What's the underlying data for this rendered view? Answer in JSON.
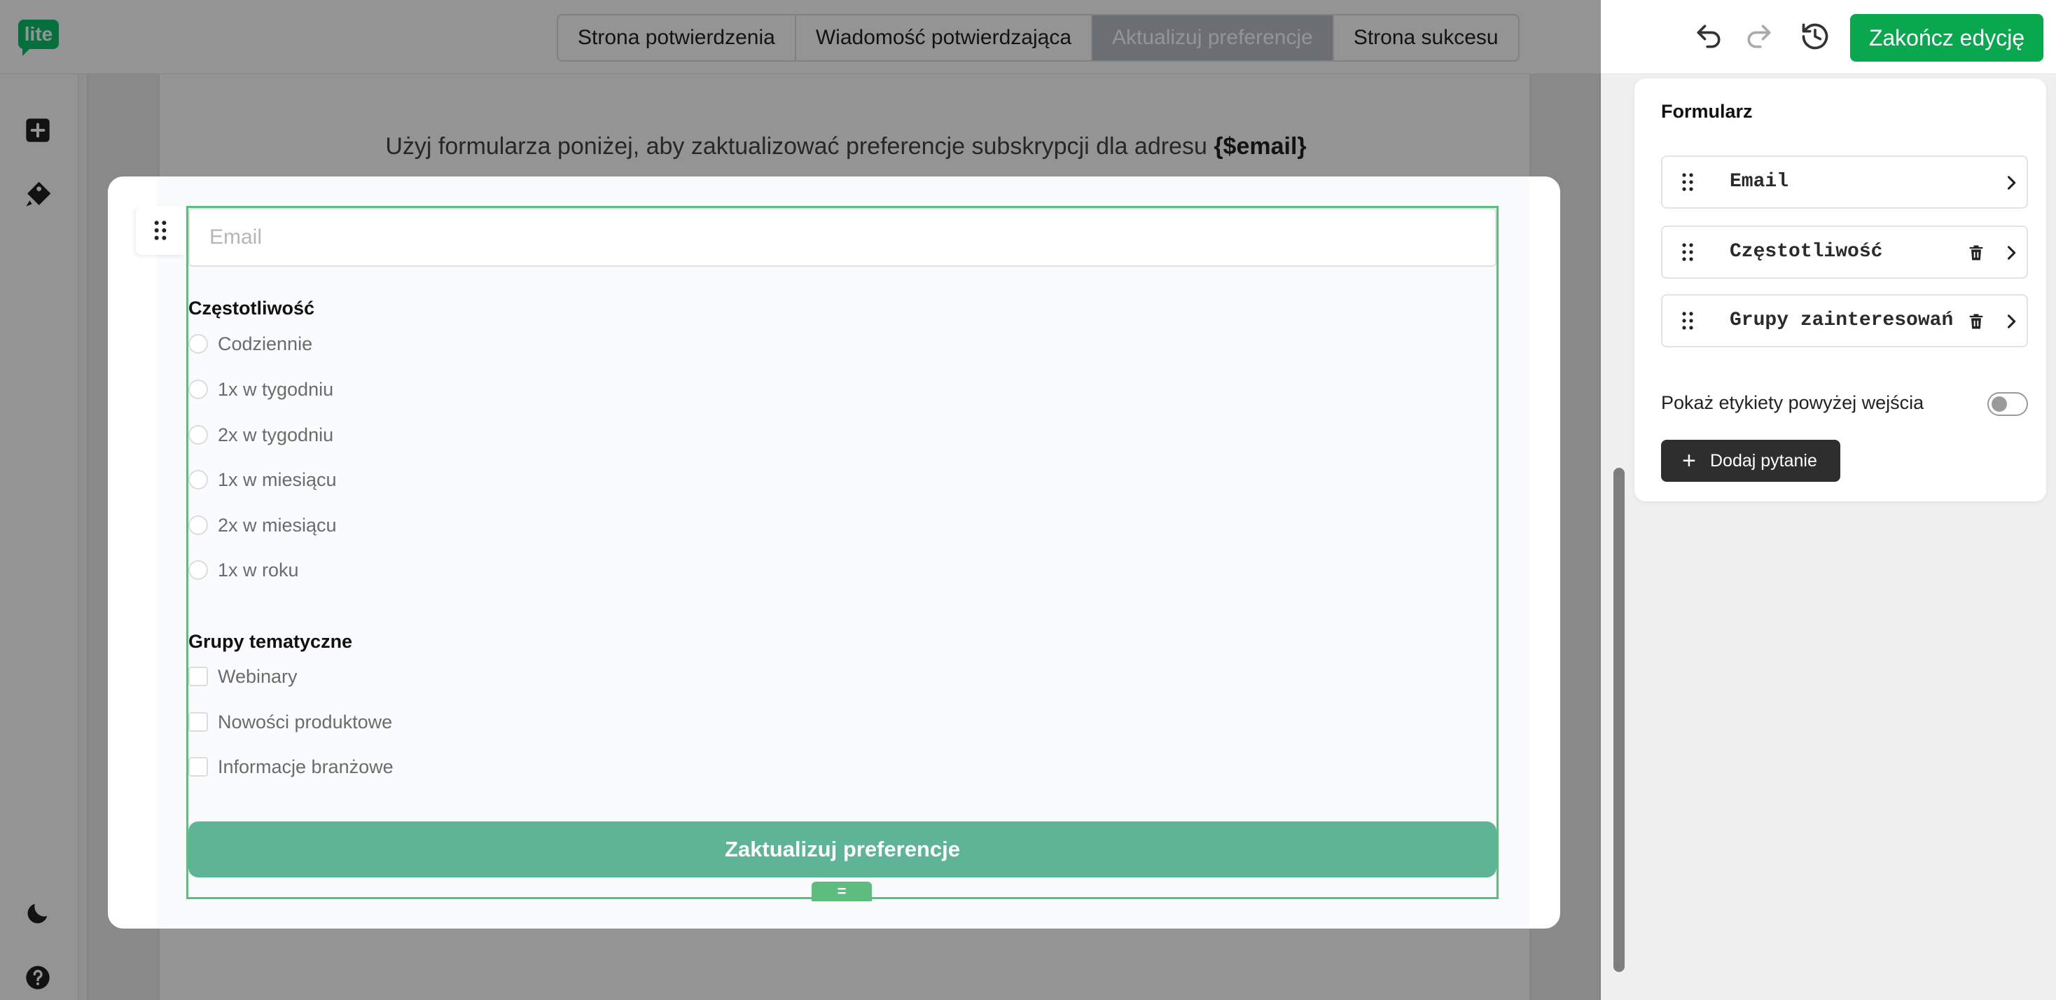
{
  "topbar": {
    "logo_text": "lite",
    "tabs": [
      {
        "label": "Strona potwierdzenia"
      },
      {
        "label": "Wiadomość potwierdzająca"
      },
      {
        "label": "Aktualizuj preferencje"
      },
      {
        "label": "Strona sukcesu"
      }
    ],
    "active_tab_index": 2,
    "finish_label": "Zakończ edycję",
    "accent_color": "#09a84f"
  },
  "leftrail": {
    "icons": [
      "add-block-icon",
      "paint-brush-icon",
      "dark-mode-moon-icon",
      "help-icon"
    ]
  },
  "page": {
    "intro_text": "Użyj formularza poniżej, aby zaktualizować preferencje subskrypcji dla adresu",
    "intro_variable": "{$email}"
  },
  "form": {
    "email_placeholder": "Email",
    "frequency_label": "Częstotliwość",
    "frequency_options": [
      "Codziennie",
      "1x w tygodniu",
      "2x w tygodniu",
      "1x w miesiącu",
      "2x w miesiącu",
      "1x w roku"
    ],
    "groups_label": "Grupy tematyczne",
    "group_options": [
      "Webinary",
      "Nowości produktowe",
      "Informacje branżowe"
    ],
    "submit_label": "Zaktualizuj preferencje",
    "resize_handle": "=",
    "button_color": "#5db596",
    "frame_color": "#5dbd7e"
  },
  "sidebar": {
    "title": "Formularz",
    "fields": [
      {
        "name": "Email",
        "deletable": false
      },
      {
        "name": "Częstotliwość",
        "deletable": true
      },
      {
        "name": "Grupy zainteresowań",
        "deletable": true
      }
    ],
    "toggle_label": "Pokaż etykiety powyżej wejścia",
    "toggle_on": false,
    "add_question_label": "Dodaj pytanie"
  }
}
